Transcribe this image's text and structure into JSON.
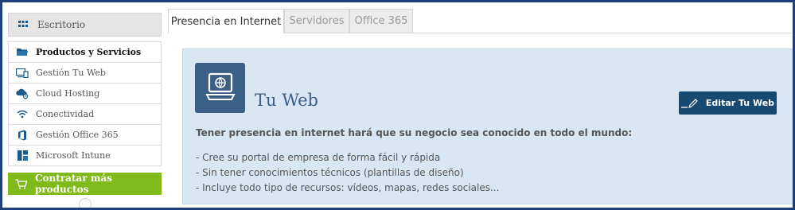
{
  "sidebar": {
    "header": {
      "label": "Escritorio",
      "icon": "grid-icon"
    },
    "items": [
      {
        "label": "Productos y Servicios",
        "icon": "folder-icon",
        "active": true
      },
      {
        "label": "Gestión Tu Web",
        "icon": "devices-icon"
      },
      {
        "label": "Cloud Hosting",
        "icon": "cloud-settings-icon"
      },
      {
        "label": "Conectividad",
        "icon": "wifi-icon"
      },
      {
        "label": "Gestión Office 365",
        "icon": "office-icon"
      },
      {
        "label": "Microsoft Intune",
        "icon": "intune-icon"
      }
    ],
    "cta": {
      "label": "Contratar más productos",
      "icon": "cart-icon"
    }
  },
  "tabs": [
    {
      "label": "Presencia en Internet",
      "active": true
    },
    {
      "label": "Servidores"
    },
    {
      "label": "Office 365"
    }
  ],
  "product": {
    "title": "Tu Web",
    "icon": "computer-globe-icon",
    "edit_button": "Editar Tu Web",
    "headline": "Tener presencia en internet hará que su negocio sea conocido en todo el mundo:",
    "bullets": [
      "- Cree su portal de empresa de forma fácil y rápida",
      "- Sin tener conocimientos técnicos (plantillas de diseño)",
      "- Incluye todo tipo de recursos: vídeos, mapas, redes sociales..."
    ]
  },
  "colors": {
    "frame": "#1d3f7a",
    "accent_green": "#7fba1a",
    "panel_bg": "#d9e6f3",
    "product_blue": "#3b5f87",
    "button_blue": "#174a73",
    "icon_blue": "#1a5a8a"
  }
}
